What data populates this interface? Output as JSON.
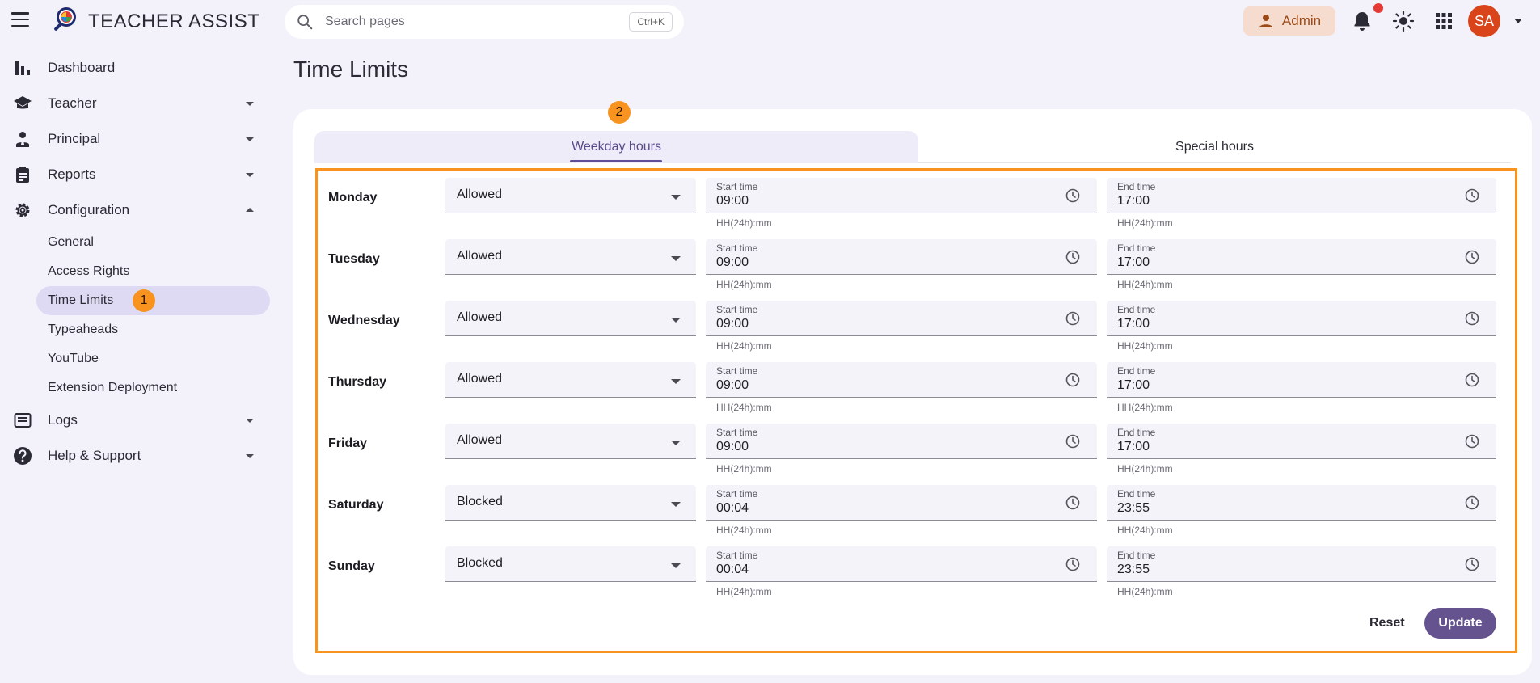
{
  "app": {
    "title": "TEACHER ASSIST"
  },
  "search": {
    "placeholder": "Search pages",
    "shortcut": "Ctrl+K"
  },
  "header": {
    "admin_label": "Admin",
    "avatar_initials": "SA",
    "notification_dot": true
  },
  "sidebar": {
    "dashboard": "Dashboard",
    "teacher": "Teacher",
    "principal": "Principal",
    "reports": "Reports",
    "configuration": "Configuration",
    "config_items": [
      "General",
      "Access Rights",
      "Time Limits",
      "Typeaheads",
      "YouTube",
      "Extension Deployment"
    ],
    "logs": "Logs",
    "help": "Help & Support"
  },
  "annotations": {
    "badge1": "1",
    "badge2": "2"
  },
  "page": {
    "title": "Time Limits"
  },
  "tabs": {
    "weekday": "Weekday hours",
    "special": "Special hours"
  },
  "fields": {
    "start_label": "Start time",
    "end_label": "End time",
    "hint": "HH(24h):mm"
  },
  "schedule": [
    {
      "day": "Monday",
      "status": "Allowed",
      "start": "09:00",
      "end": "17:00"
    },
    {
      "day": "Tuesday",
      "status": "Allowed",
      "start": "09:00",
      "end": "17:00"
    },
    {
      "day": "Wednesday",
      "status": "Allowed",
      "start": "09:00",
      "end": "17:00"
    },
    {
      "day": "Thursday",
      "status": "Allowed",
      "start": "09:00",
      "end": "17:00"
    },
    {
      "day": "Friday",
      "status": "Allowed",
      "start": "09:00",
      "end": "17:00"
    },
    {
      "day": "Saturday",
      "status": "Blocked",
      "start": "00:04",
      "end": "23:55"
    },
    {
      "day": "Sunday",
      "status": "Blocked",
      "start": "00:04",
      "end": "23:55"
    }
  ],
  "actions": {
    "reset": "Reset",
    "update": "Update"
  },
  "colors": {
    "accent": "#65538f",
    "highlight": "#f7931e",
    "avatar": "#d9441b",
    "admin_bg": "#f6dccf"
  }
}
